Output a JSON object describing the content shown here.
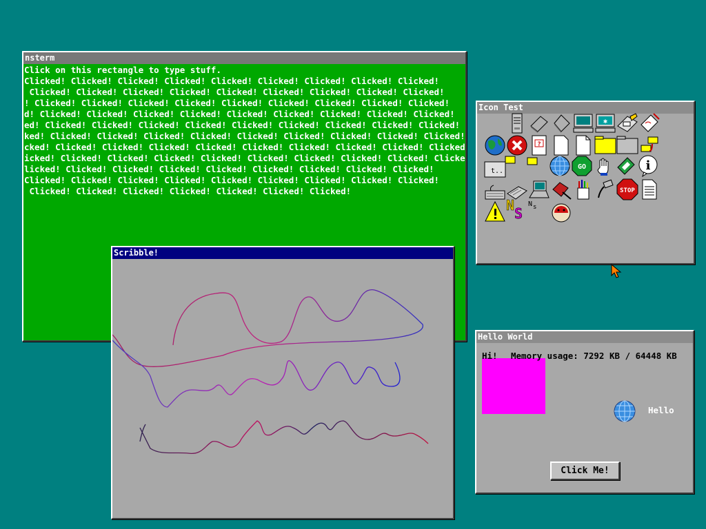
{
  "windows": {
    "nsterm": {
      "title": "nsterm",
      "lines": [
        "Click on this rectangle to type stuff.",
        "Clicked! Clicked! Clicked! Clicked! Clicked! Clicked! Clicked! Clicked! Clicked!",
        " Clicked! Clicked! Clicked! Clicked! Clicked! Clicked! Clicked! Clicked! Clicked!",
        "! Clicked! Clicked! Clicked! Clicked! Clicked! Clicked! Clicked! Clicked! Clicked!",
        "d! Clicked! Clicked! Clicked! Clicked! Clicked! Clicked! Clicked! Clicked! Clicked!",
        "ed! Clicked! Clicked! Clicked! Clicked! Clicked! Clicked! Clicked! Clicked! Clicked!",
        "ked! Clicked! Clicked! Clicked! Clicked! Clicked! Clicked! Clicked! Clicked! Clicked!",
        "cked! Clicked! Clicked! Clicked! Clicked! Clicked! Clicked! Clicked! Clicked! Clicked!",
        "icked! Clicked! Clicked! Clicked! Clicked! Clicked! Clicked! Clicked! Clicked! Clicked!",
        "licked! Clicked! Clicked! Clicked! Clicked! Clicked! Clicked! Clicked! Clicked!",
        "Clicked! Clicked! Clicked! Clicked! Clicked! Clicked! Clicked! Clicked! Clicked!",
        " Clicked! Clicked! Clicked! Clicked! Clicked! Clicked! Clicked!"
      ]
    },
    "icon_test": {
      "title": "Icon Test",
      "icons": [
        "server",
        "cpu-chip",
        "cpu-chip-2",
        "computer",
        "computer-network",
        "pen-pad",
        "tag-certificate",
        "globe",
        "close-error",
        "help-document",
        "blank-document",
        "blank-document-2",
        "folder-yellow",
        "folder-gray",
        "folder-stack",
        "globe-earth",
        "error-x",
        "help-page",
        "page",
        "page-folded",
        "folder-open",
        "folder-closed",
        "folder-tree",
        "up-folder",
        "small-folder",
        "small-folder-2",
        "sphere-globe",
        "go-button",
        "hand-pointer",
        "book-install",
        "info-balloon",
        "keyboard",
        "keyboard-2",
        "laptop",
        "book-pen",
        "pencils-cup",
        "plug-connector",
        "stop-sign",
        "text-document",
        "warning-triangle",
        "letter-n",
        "ns-logo",
        "mouse-ladybug"
      ],
      "stop_label": "STOP",
      "go_label": "GO"
    },
    "hello_world": {
      "title": "Hello World",
      "hi": "Hi!",
      "memory": "Memory usage: 7292 KB / 64448 KB",
      "hello_label": "Hello",
      "button_label": "Click Me!"
    },
    "scribble": {
      "title": "Scribble!"
    }
  },
  "colors": {
    "desktop": "#008080",
    "terminal_bg": "#00a800",
    "window_bg": "#a8a8a8",
    "active_title": "#000080",
    "magenta_box": "#ff00ff"
  }
}
